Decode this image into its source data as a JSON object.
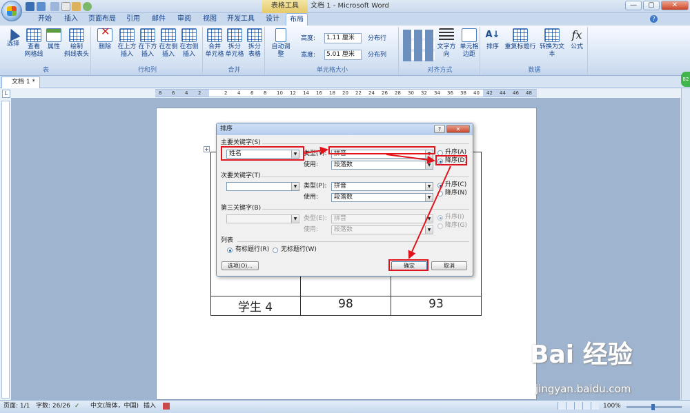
{
  "window": {
    "title": "文档 1 - Microsoft Word",
    "context_tab_group": "表格工具",
    "controls": [
      "—",
      "▢",
      "✕"
    ]
  },
  "ribbon_tabs": [
    "开始",
    "插入",
    "页面布局",
    "引用",
    "邮件",
    "审阅",
    "视图",
    "开发工具",
    "设计",
    "布局"
  ],
  "active_tab": "布局",
  "groups": {
    "table": {
      "label": "表",
      "buttons": [
        "选择",
        "查看\n网格线",
        "属性",
        "绘制\n斜线表头"
      ]
    },
    "rows_cols": {
      "label": "行和列",
      "buttons": [
        "删除",
        "在上方\n插入",
        "在下方\n插入",
        "在左侧\n插入",
        "在右侧\n插入"
      ]
    },
    "merge": {
      "label": "合并",
      "buttons": [
        "合并\n单元格",
        "拆分\n单元格",
        "拆分\n表格"
      ]
    },
    "cell_size": {
      "label": "单元格大小",
      "autofit": "自动调整",
      "height_label": "高度:",
      "height_value": "1.11 厘米",
      "width_label": "宽度:",
      "width_value": "5.01 厘米",
      "distribute_rows": "分布行",
      "distribute_cols": "分布列"
    },
    "alignment": {
      "label": "对齐方式",
      "buttons": [
        "文字方向",
        "单元格\n边距"
      ]
    },
    "data": {
      "label": "数据",
      "buttons": [
        "排序",
        "重复标题行",
        "转换为文本",
        "公式"
      ]
    }
  },
  "doc_tab": "文档 1 *",
  "ruler_numbers": [
    "8",
    "6",
    "4",
    "2",
    "",
    "2",
    "4",
    "6",
    "8",
    "10",
    "12",
    "14",
    "16",
    "18",
    "20",
    "22",
    "24",
    "26",
    "28",
    "30",
    "32",
    "34",
    "36",
    "38",
    "40",
    "42",
    "44",
    "46",
    "48"
  ],
  "table_last_row": [
    "学生 4",
    "98",
    "93"
  ],
  "dialog": {
    "title": "排序",
    "help": "?",
    "close": "✕",
    "primary": {
      "label": "主要关键字(S)",
      "field": "姓名",
      "type_label": "类型(Y):",
      "type_value": "拼音",
      "use_label": "使用:",
      "use_value": "段落数",
      "asc": "升序(A)",
      "desc": "降序(D)",
      "selected": "desc"
    },
    "secondary": {
      "label": "次要关键字(T)",
      "field": "",
      "type_label": "类型(P):",
      "type_value": "拼音",
      "use_label": "使用:",
      "use_value": "段落数",
      "asc": "升序(C)",
      "desc": "降序(N)",
      "selected": "asc"
    },
    "tertiary": {
      "label": "第三关键字(B)",
      "field": "",
      "type_label": "类型(E):",
      "type_value": "拼音",
      "use_label": "使用:",
      "use_value": "段落数",
      "asc": "升序(I)",
      "desc": "降序(G)",
      "selected": "asc"
    },
    "list": {
      "label": "列表",
      "has_header": "有标题行(R)",
      "no_header": "无标题行(W)",
      "selected": "has_header"
    },
    "options_button": "选项(O)...",
    "ok_button": "确定",
    "cancel_button": "取消"
  },
  "status": {
    "page": "页面: 1/1",
    "words": "字数: 26/26",
    "language": "中文(简体，中国)",
    "mode": "插入",
    "zoom": "100%"
  },
  "watermark": {
    "logo": "Bai 经验",
    "url": "jingyan.baidu.com"
  },
  "badge": "82",
  "accent_red": "#e0141c"
}
